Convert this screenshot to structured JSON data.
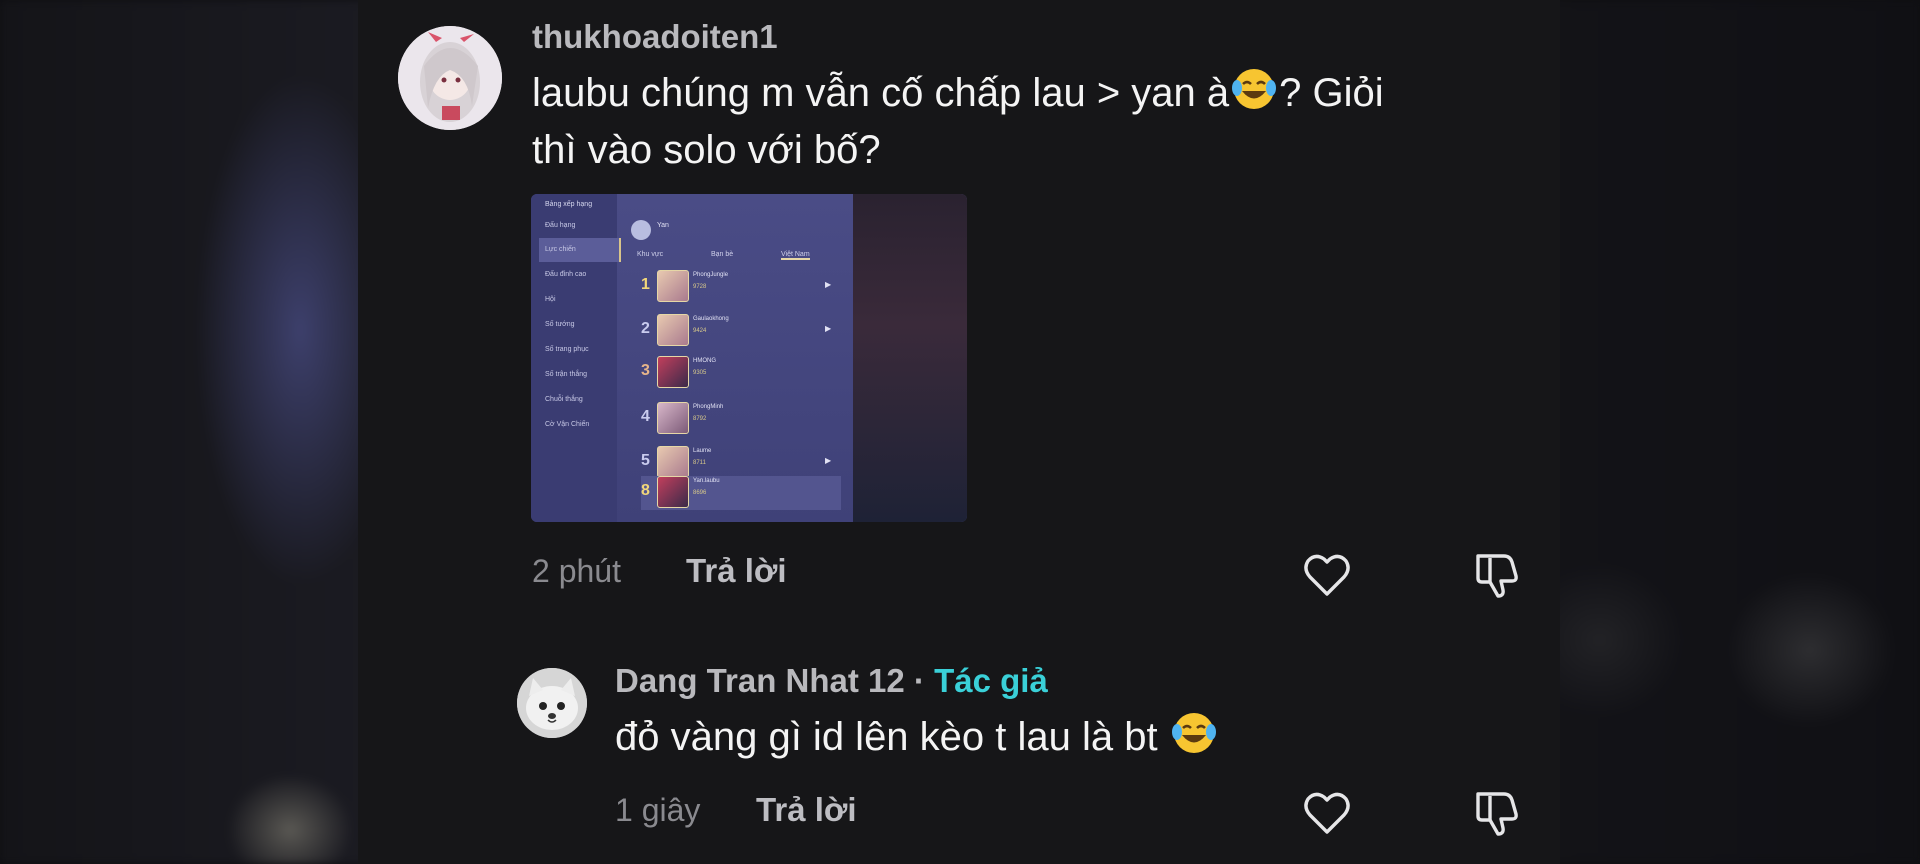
{
  "comments": [
    {
      "username": "thukhoadoiten1",
      "text_line1": "laubu chúng m vẫn cố chấp lau > yan à",
      "text_line1_end": "? Giỏi",
      "text_line2": "thì vào solo với bố?",
      "time": "2 phút",
      "reply_label": "Trả lời",
      "has_image": true
    },
    {
      "username": "Dang Tran Nhat 12",
      "separator": " · ",
      "author_badge": "Tác giả",
      "text": "đỏ vàng gì id lên kèo t lau là bt ",
      "time": "1 giây",
      "reply_label": "Trả lời"
    }
  ],
  "attached_image": {
    "header": "Bảng xếp hạng",
    "sidebar": [
      "Đấu hạng",
      "Lực chiến",
      "Đấu đỉnh cao",
      "Hội",
      "Số tướng",
      "Số trang phục",
      "Số trận thắng",
      "Chuỗi thắng",
      "Cờ Vận Chiến"
    ],
    "player_name": "Yan",
    "tabs": [
      "Khu vực",
      "Bạn bè",
      "Việt Nam"
    ],
    "ranks": [
      {
        "rank": "1",
        "name": "PhongJungle",
        "score": "9728"
      },
      {
        "rank": "2",
        "name": "Gaulaokhong",
        "score": "9424"
      },
      {
        "rank": "3",
        "name": "HMONG",
        "score": "9305"
      },
      {
        "rank": "4",
        "name": "PhongMinh",
        "score": "8792"
      },
      {
        "rank": "5",
        "name": "Laume",
        "score": "8711"
      },
      {
        "rank": "8",
        "name": "Yan.laubu",
        "score": "8696"
      }
    ]
  },
  "icons": {
    "like": "heart-outline-icon",
    "dislike": "thumbs-down-outline-icon",
    "emoji": "laughing-tears-emoji"
  },
  "colors": {
    "background": "#161618",
    "author_badge": "#3ad0d8",
    "username": "#b9b9bd",
    "meta": "#8a8a8f"
  }
}
